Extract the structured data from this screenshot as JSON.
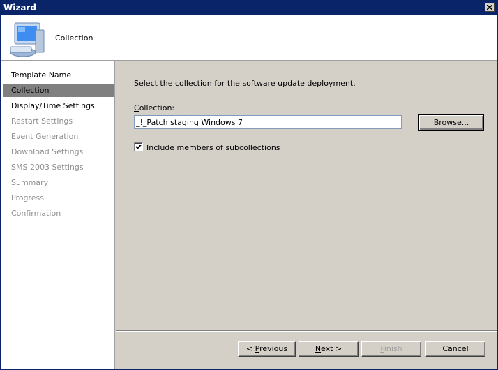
{
  "window": {
    "title": "Wizard"
  },
  "header": {
    "title": "Collection",
    "icon": "computer-icon"
  },
  "sidebar": {
    "items": [
      {
        "label": "Template Name",
        "state": "done"
      },
      {
        "label": "Collection",
        "state": "active"
      },
      {
        "label": "Display/Time Settings",
        "state": "done"
      },
      {
        "label": "Restart Settings",
        "state": "pending"
      },
      {
        "label": "Event Generation",
        "state": "pending"
      },
      {
        "label": "Download Settings",
        "state": "pending"
      },
      {
        "label": "SMS 2003 Settings",
        "state": "pending"
      },
      {
        "label": "Summary",
        "state": "pending"
      },
      {
        "label": "Progress",
        "state": "pending"
      },
      {
        "label": "Confirmation",
        "state": "pending"
      }
    ]
  },
  "main": {
    "instruction": "Select the collection for the software update deployment.",
    "collection_label_mnemonic": "C",
    "collection_label_rest": "ollection:",
    "collection_value": "_!_Patch staging Windows 7",
    "browse_mnemonic": "B",
    "browse_rest": "rowse...",
    "include_mnemonic": "I",
    "include_rest": "nclude members of subcollections",
    "include_checked": true
  },
  "footer": {
    "previous_pre": "< ",
    "previous_mnemonic": "P",
    "previous_rest": "revious",
    "next_mnemonic": "N",
    "next_rest": "ext >",
    "finish_mnemonic": "F",
    "finish_rest": "inish",
    "cancel": "Cancel"
  },
  "colors": {
    "titlebar": "#0a246a",
    "selected_item": "#808080",
    "dialog_bg": "#d4d0c8"
  }
}
